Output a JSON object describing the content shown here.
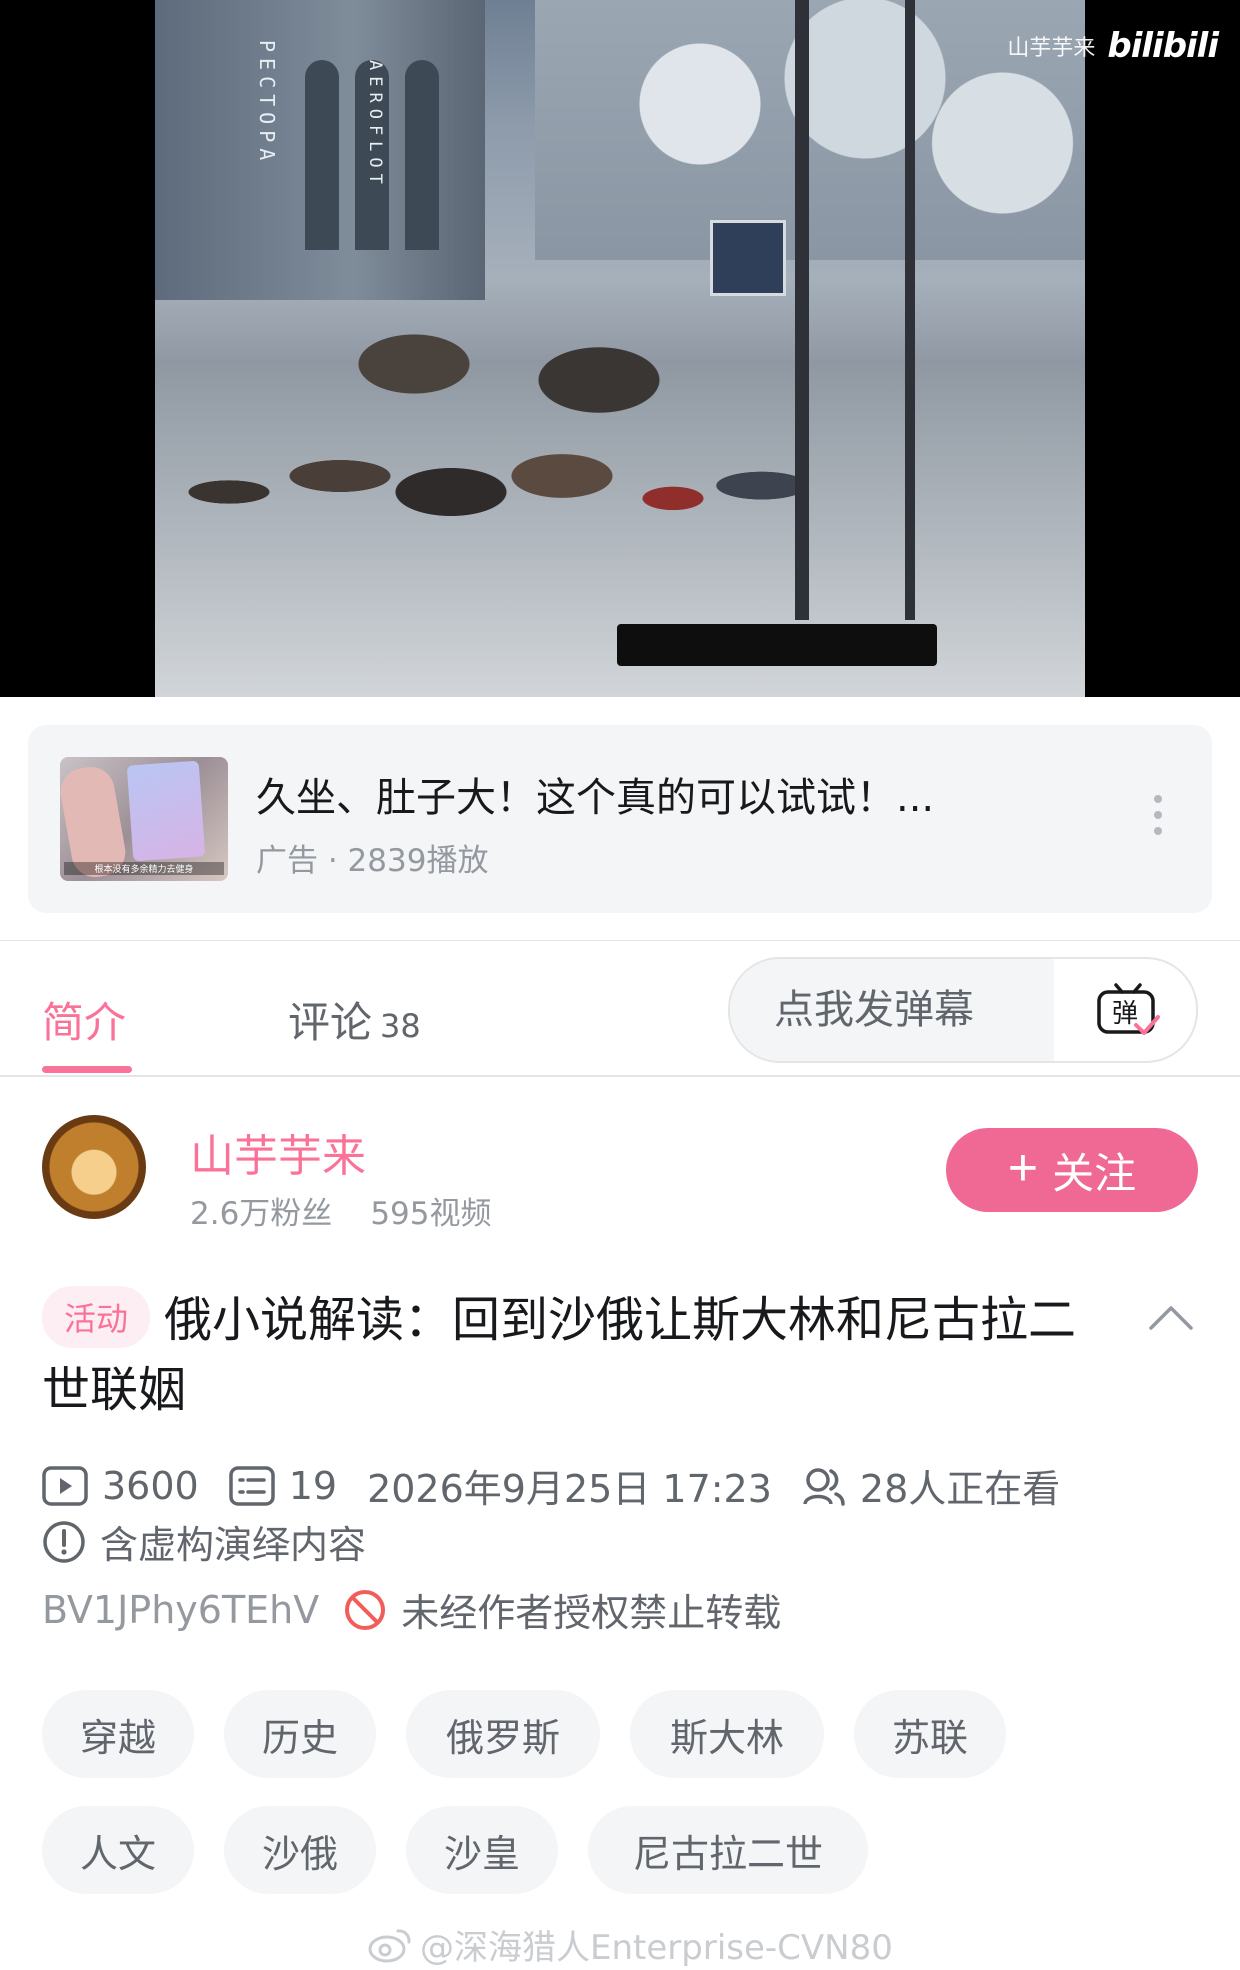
{
  "player": {
    "watermark_uploader": "山芋芋来",
    "watermark_logo": "bilibili",
    "scene_signs": [
      "PECTOPA",
      "AEROFLOT"
    ]
  },
  "ad": {
    "title": "久坐、肚子大！这个真的可以试试！...",
    "meta": "广告 · 2839播放",
    "thumb_caption": "根本没有多余精力去健身"
  },
  "tabs": {
    "intro_label": "简介",
    "comments_label": "评论",
    "comments_count": "38",
    "danmaku_placeholder": "点我发弹幕",
    "danmaku_icon_char": "弹"
  },
  "uploader": {
    "name": "山芋芋来",
    "fans": "2.6万粉丝",
    "videos": "595视频",
    "follow_label": "关注"
  },
  "video": {
    "activity_tag": "活动",
    "title": "俄小说解读：回到沙俄让斯大林和尼古拉二世联姻",
    "plays": "3600",
    "danmaku_count": "19",
    "date": "2026年9月25日 17:23",
    "watching": "28人正在看",
    "fiction_notice": "含虚构演绎内容",
    "bvid": "BV1JPhy6TEhV",
    "repost_notice": "未经作者授权禁止转载"
  },
  "tags": [
    "穿越",
    "历史",
    "俄罗斯",
    "斯大林",
    "苏联",
    "人文",
    "沙俄",
    "沙皇",
    "尼古拉二世"
  ],
  "colors": {
    "accent_pink": "#fb7299",
    "follow_pink": "#f06994",
    "muted_text": "#9499a0",
    "secondary_text": "#61666d",
    "forbid_red": "#f25d59"
  },
  "footer": {
    "weibo_watermark": "@深海猎人Enterprise-CVN80"
  }
}
